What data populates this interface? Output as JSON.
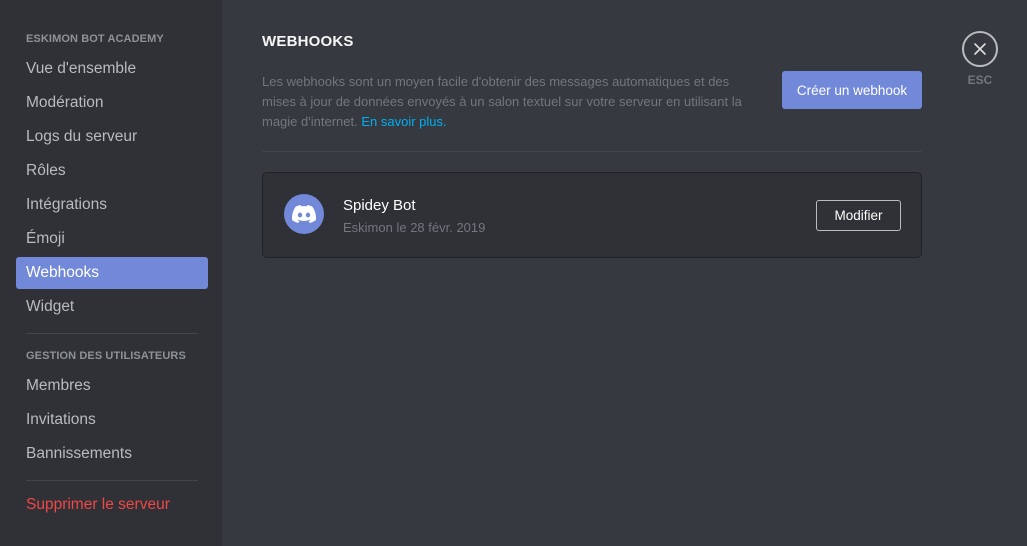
{
  "sidebar": {
    "server_header": "ESKIMON BOT ACADEMY",
    "server_items": [
      {
        "label": "Vue d'ensemble"
      },
      {
        "label": "Modération"
      },
      {
        "label": "Logs du serveur"
      },
      {
        "label": "Rôles"
      },
      {
        "label": "Intégrations"
      },
      {
        "label": "Émoji"
      },
      {
        "label": "Webhooks",
        "active": true
      },
      {
        "label": "Widget"
      }
    ],
    "users_header": "GESTION DES UTILISATEURS",
    "user_items": [
      {
        "label": "Membres"
      },
      {
        "label": "Invitations"
      },
      {
        "label": "Bannissements"
      }
    ],
    "delete_label": "Supprimer le serveur"
  },
  "main": {
    "title": "WEBHOOKS",
    "description": "Les webhooks sont un moyen facile d'obtenir des messages automatiques et des mises à jour de données envoyés à un salon textuel sur votre serveur en utilisant la magie d'internet.",
    "learn_more": "En savoir plus.",
    "create_button": "Créer un webhook",
    "webhooks": [
      {
        "name": "Spidey Bot",
        "meta": "Eskimon le 28 févr. 2019",
        "edit_label": "Modifier",
        "avatar_icon": "discord-logo-icon"
      }
    ]
  },
  "close": {
    "icon": "close-icon",
    "label": "ESC"
  },
  "colors": {
    "accent": "#7289da",
    "danger": "#f04747",
    "link": "#00b0f4",
    "background": "#36393f",
    "sidebar": "#2f3136"
  }
}
